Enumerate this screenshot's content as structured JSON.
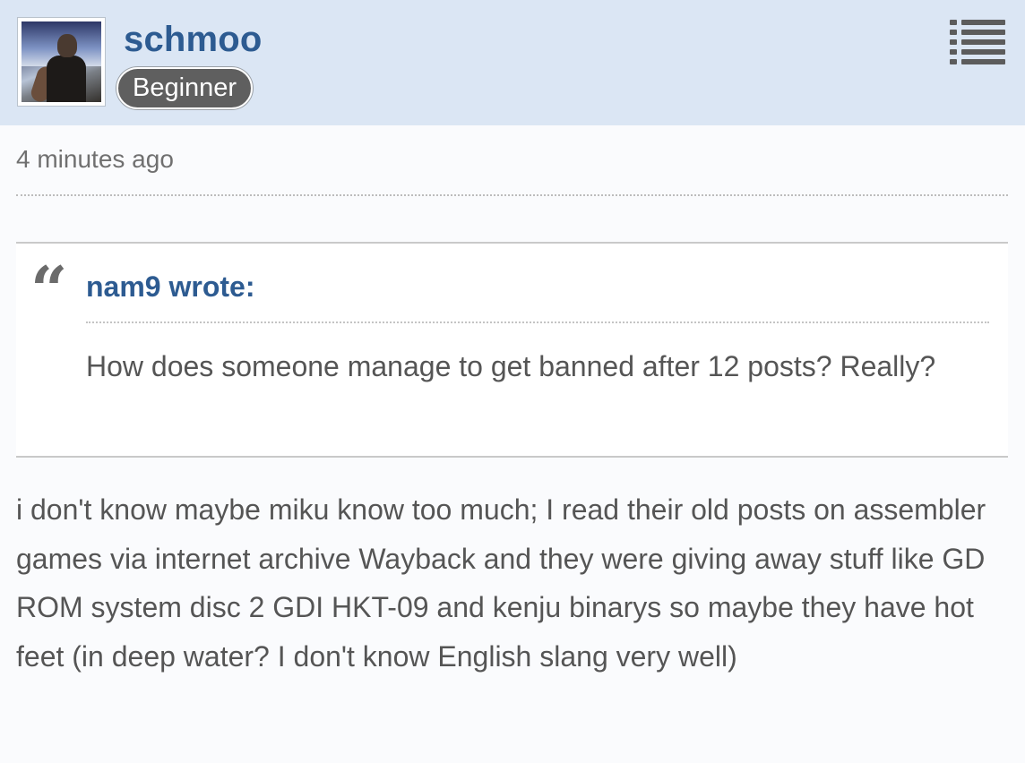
{
  "post": {
    "author": {
      "username": "schmoo",
      "rank": "Beginner",
      "avatar_icon": "user-avatar-photo"
    },
    "menu_icon": "list-menu-icon",
    "timestamp": "4 minutes ago",
    "quote": {
      "icon": "quote-icon",
      "author_line": "nam9 wrote:",
      "text": "How does someone manage to get banned after 12 posts? Really?"
    },
    "body": "i don't know maybe miku know too much; I read their old posts on assembler games via internet archive Wayback and they were giving away stuff like GD ROM system disc 2 GDI HKT-09 and kenju binarys so maybe they have hot feet (in deep water? I don't know English slang very well)"
  },
  "colors": {
    "header_background": "#dbe6f4",
    "username": "#2d5b91",
    "rank_badge": "#5f5f5f",
    "body_text": "#555555",
    "page_background": "#fafbfd"
  }
}
